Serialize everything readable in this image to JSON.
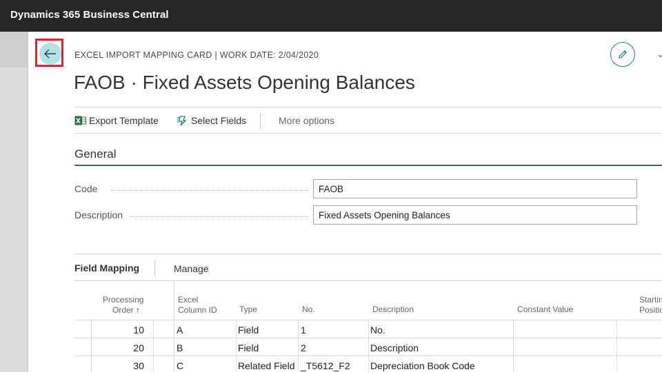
{
  "app": {
    "title": "Dynamics 365 Business Central"
  },
  "page": {
    "caption": "EXCEL IMPORT MAPPING CARD | WORK DATE: 2/04/2020",
    "title": "FAOB · Fixed Assets Opening Balances"
  },
  "actions": {
    "export_template": "Export Template",
    "select_fields": "Select Fields",
    "more_options": "More options"
  },
  "general": {
    "heading": "General",
    "code_label": "Code",
    "code_value": "FAOB",
    "description_label": "Description",
    "description_value": "Fixed Assets Opening Balances"
  },
  "field_mapping": {
    "tab": "Field Mapping",
    "manage": "Manage",
    "columns": {
      "processing": "Processing",
      "order": "Order",
      "sort_arrow": "↑",
      "excel": "Excel",
      "column_id": "Column ID",
      "type": "Type",
      "no": "No.",
      "description": "Description",
      "constant_value": "Constant Value",
      "starting": "Startin",
      "position": "Positio"
    },
    "rows": [
      {
        "order": "10",
        "col": "A",
        "type": "Field",
        "no": "1",
        "description": "No."
      },
      {
        "order": "20",
        "col": "B",
        "type": "Field",
        "no": "2",
        "description": "Description"
      },
      {
        "order": "30",
        "col": "C",
        "type": "Related Field",
        "no": "_T5612_F2",
        "description": "Depreciation Book Code"
      }
    ]
  },
  "colors": {
    "accent": "#1a7f8b",
    "back_button_bg": "#b2e2e6",
    "highlight_border": "#d9262c",
    "topbar": "#262626"
  },
  "icons": {
    "back": "back-arrow-icon",
    "edit": "pencil-icon",
    "excel": "excel-icon",
    "select_fields": "select-fields-icon",
    "more": "chevron-down-icon"
  }
}
